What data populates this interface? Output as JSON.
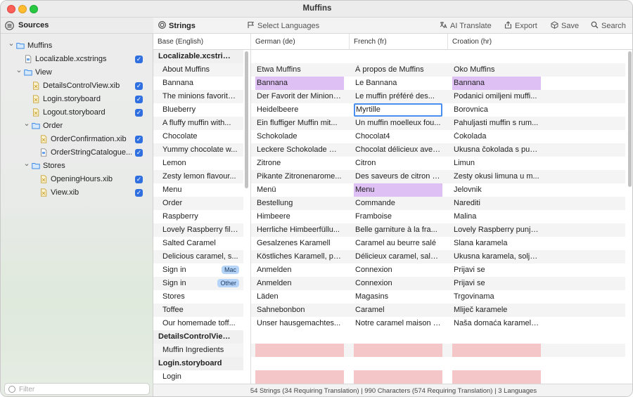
{
  "window": {
    "title": "Muffins"
  },
  "sidebar": {
    "title": "Sources",
    "filter_placeholder": "Filter",
    "tree": [
      {
        "label": "Muffins",
        "icon": "folder-icon",
        "depth": 0,
        "disclosure": "expanded",
        "checked": null
      },
      {
        "label": "Localizable.xcstrings",
        "icon": "strings-file-icon",
        "depth": 1,
        "disclosure": "none",
        "checked": true
      },
      {
        "label": "View",
        "icon": "folder-icon",
        "depth": 1,
        "disclosure": "expanded",
        "checked": null
      },
      {
        "label": "DetailsControlView.xib",
        "icon": "xib-file-icon",
        "depth": 2,
        "disclosure": "none",
        "checked": true
      },
      {
        "label": "Login.storyboard",
        "icon": "storyboard-file-icon",
        "depth": 2,
        "disclosure": "none",
        "checked": true
      },
      {
        "label": "Logout.storyboard",
        "icon": "storyboard-file-icon",
        "depth": 2,
        "disclosure": "none",
        "checked": true
      },
      {
        "label": "Order",
        "icon": "folder-icon",
        "depth": 2,
        "disclosure": "expanded",
        "checked": null
      },
      {
        "label": "OrderConfirmation.xib",
        "icon": "xib-file-icon",
        "depth": 3,
        "disclosure": "none",
        "checked": true
      },
      {
        "label": "OrderStringCatalogue....",
        "icon": "strings-file-icon",
        "depth": 3,
        "disclosure": "none",
        "checked": true
      },
      {
        "label": "Stores",
        "icon": "folder-icon",
        "depth": 2,
        "disclosure": "expanded",
        "checked": null
      },
      {
        "label": "OpeningHours.xib",
        "icon": "xib-file-icon",
        "depth": 3,
        "disclosure": "none",
        "checked": true
      },
      {
        "label": "View.xib",
        "icon": "xib-file-icon",
        "depth": 3,
        "disclosure": "none",
        "checked": true
      }
    ]
  },
  "toolbar": {
    "strings_label": "Strings",
    "select_languages_label": "Select Languages",
    "ai_translate_label": "AI Translate",
    "export_label": "Export",
    "save_label": "Save",
    "search_label": "Search"
  },
  "table": {
    "columns": [
      "Base (English)",
      "German (de)",
      "French (fr)",
      "Croation (hr)"
    ],
    "rows": [
      {
        "type": "section",
        "base": "Localizable.xcstrings"
      },
      {
        "type": "string",
        "base": "About Muffins",
        "de": "Etwa Muffins",
        "fr": "À propos de Muffins",
        "hr": "Oko Muffins"
      },
      {
        "type": "string",
        "base": "Bannana",
        "de": "Bannana",
        "fr": "Le Bannana",
        "hr": "Bannana",
        "highlight": [
          "de",
          "hr"
        ]
      },
      {
        "type": "string",
        "base": "The minions favorite...",
        "de": "Der Favorit der Minions...",
        "fr": "Le muffin préféré des...",
        "hr": "Podanici omiljeni muffi..."
      },
      {
        "type": "string",
        "base": "Blueberry",
        "de": "Heidelbeere",
        "fr": "Myrtille",
        "hr": "Borovnica",
        "editing": "fr"
      },
      {
        "type": "string",
        "base": "A fluffy muffin with...",
        "de": "Ein fluffiger Muffin mit...",
        "fr": "Un muffin moelleux fou...",
        "hr": "Pahuljasti muffin s rum..."
      },
      {
        "type": "string",
        "base": "Chocolate",
        "de": "Schokolade",
        "fr": "Chocolat4",
        "hr": "Čokolada"
      },
      {
        "type": "string",
        "base": "Yummy chocolate w...",
        "de": "Leckere Schokolade mi...",
        "fr": "Chocolat délicieux avec...",
        "hr": "Ukusna čokolada s pun..."
      },
      {
        "type": "string",
        "base": "Lemon",
        "de": "Zitrone",
        "fr": "Citron",
        "hr": "Limun"
      },
      {
        "type": "string",
        "base": "Zesty lemon flavour...",
        "de": "Pikante Zitronenarome...",
        "fr": "Des saveurs de citron p...",
        "hr": "Zesty okusi limuna u m..."
      },
      {
        "type": "string",
        "base": "Menu",
        "de": "Menü",
        "fr": "Menu",
        "hr": "Jelovnik",
        "highlight": [
          "fr"
        ]
      },
      {
        "type": "string",
        "base": "Order",
        "de": "Bestellung",
        "fr": "Commande",
        "hr": "Narediti"
      },
      {
        "type": "string",
        "base": "Raspberry",
        "de": "Himbeere",
        "fr": "Framboise",
        "hr": "Malina"
      },
      {
        "type": "string",
        "base": "Lovely Raspberry fill...",
        "de": "Herrliche Himbeerfüllu...",
        "fr": "Belle garniture à la fra...",
        "hr": "Lovely Raspberry punje..."
      },
      {
        "type": "string",
        "base": "Salted Caramel",
        "de": "Gesalzenes Karamell",
        "fr": "Caramel au beurre salé",
        "hr": "Slana karamela"
      },
      {
        "type": "string",
        "base": "Delicious caramel, s...",
        "de": "Köstliches Karamell, pe...",
        "fr": "Délicieux caramel, salé...",
        "hr": "Ukusna karamela, solje..."
      },
      {
        "type": "string",
        "base": "Sign in",
        "tag": "Mac",
        "de": "Anmelden",
        "fr": "Connexion",
        "hr": "Prijavi se"
      },
      {
        "type": "string",
        "base": "Sign in",
        "tag": "Other",
        "de": "Anmelden",
        "fr": "Connexion",
        "hr": "Prijavi se"
      },
      {
        "type": "string",
        "base": "Stores",
        "de": "Läden",
        "fr": "Magasins",
        "hr": "Trgovinama"
      },
      {
        "type": "string",
        "base": "Toffee",
        "de": "Sahnebonbon",
        "fr": "Caramel",
        "hr": "Mliječ karamele"
      },
      {
        "type": "string",
        "base": "Our homemade toff...",
        "de": "Unser hausgemachtes...",
        "fr": "Notre caramel maison f...",
        "hr": "Naša domaća karamela..."
      },
      {
        "type": "section",
        "base": "DetailsControlView...."
      },
      {
        "type": "string",
        "base": "Muffin Ingredients",
        "de": "",
        "fr": "",
        "hr": "",
        "missing": true
      },
      {
        "type": "section",
        "base": "Login.storyboard"
      },
      {
        "type": "string",
        "base": "Login",
        "de": "",
        "fr": "",
        "hr": "",
        "missing": true
      }
    ]
  },
  "status_bar": {
    "text": "54 Strings (34 Requiring Translation) | 990 Characters (574 Requiring Translation) | 3 Languages"
  },
  "colors": {
    "highlight": "#dec0f5",
    "missing": "#f5c6c8",
    "accent": "#2f6fdf",
    "edit_border": "#4a8ef0"
  }
}
